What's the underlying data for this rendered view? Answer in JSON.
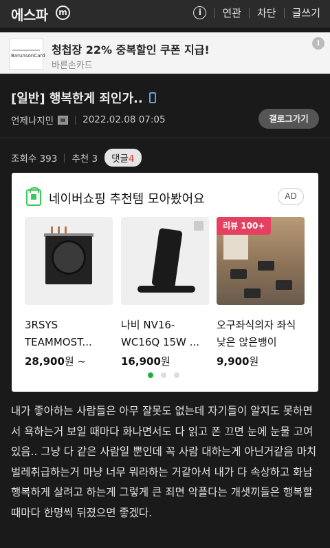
{
  "header": {
    "site_name": "에스파",
    "logo_letter": "m",
    "info_label": "i",
    "nav": [
      "연관",
      "차단",
      "글쓰기"
    ]
  },
  "ad_banner": {
    "logo_text": "BarunsonCard",
    "title": "청첩장 22% 중복할인 쿠폰 지급!",
    "advertiser": "바른손카드",
    "info_label": "i"
  },
  "post": {
    "title": "[일반] 행복한게 죄인가..",
    "author": "언제나지민",
    "datetime": "2022.02.08 07:05",
    "gallery_button": "갤로그가기",
    "views_label": "조회수 393",
    "recommend_label": "추천 3",
    "comment_label": "댓글",
    "comment_count": "4",
    "body": "내가 좋아하는 사람들은 아무 잘못도 없는데 자기들이 알지도 못하면서 욕하는거 보일 때마다 화나면서도 다 읽고 폰 끄면 눈에 눈물 고여있음.. 그냥 다 같은 사람일 뿐인데  꼭 사람 대하는게 아닌거같음 마치 벌레취급하는거 마냥 너무 뭐라하는 거같아서 내가 다 속상하고 화남 행복하게 살려고 하는게 그렇게 큰 죄면 악플다는 개샛끼들은 행복할때마다  한명씩 뒤졌으면 좋겠다."
  },
  "shopping": {
    "title": "네이버쇼핑 추천템 모아봤어요",
    "ad_badge": "AD",
    "products": [
      {
        "name": "3RSYS TEAMMOST...",
        "price": "28,900",
        "suffix": "원 ~",
        "badge": ""
      },
      {
        "name": "나비 NV16-WC16Q 15W ...",
        "price": "16,900",
        "suffix": "원",
        "badge": ""
      },
      {
        "name": "오구좌식의자 좌식 낮은 앉은뱅이",
        "price": "9,900",
        "suffix": "원",
        "badge": "리뷰 100+"
      }
    ],
    "pagination": {
      "total": 3,
      "active": 1
    }
  },
  "colors": {
    "background": "#1a1a1a",
    "accent_green": "#1fae3f",
    "comment_count": "#e0412b",
    "review_badge": "#e4405f"
  }
}
